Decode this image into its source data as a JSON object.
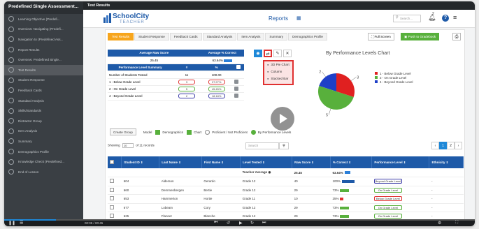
{
  "sidebar": {
    "title": "Predefined Single Assessment...",
    "items": [
      {
        "label": "Learning Objective (Predefi..."
      },
      {
        "label": "Overview: Navigating (Predefi..."
      },
      {
        "label": "Navigation to (Predefined Ass..."
      },
      {
        "label": "Report Results"
      },
      {
        "label": "Overview: Predefined Single..."
      },
      {
        "label": "Test Results"
      },
      {
        "label": "Student Response"
      },
      {
        "label": "Feedback Cards"
      },
      {
        "label": "Standard Analysis"
      },
      {
        "label": "Skills/Standards"
      },
      {
        "label": "Distractor Group"
      },
      {
        "label": "Item Analysis"
      },
      {
        "label": "Summary"
      },
      {
        "label": "Demographics Profile"
      },
      {
        "label": "Knowledge Check (Predefined..."
      },
      {
        "label": "End of Lesson"
      }
    ]
  },
  "topbar": {
    "title": "Test Results"
  },
  "app": {
    "logo_main": "SchoolCity",
    "logo_sub": "TEACHER",
    "page_title": "Reports",
    "search_placeholder": "Search...",
    "notification_count": "2",
    "help_label": "?"
  },
  "tabs": [
    {
      "label": "Test Results"
    },
    {
      "label": "Student Response"
    },
    {
      "label": "Feedback Cards"
    },
    {
      "label": "Standard Analysis"
    },
    {
      "label": "Item Analysis"
    },
    {
      "label": "Summary"
    },
    {
      "label": "Demographics Profile"
    }
  ],
  "toolbar": {
    "fullscreen_label": "Full Screen",
    "push_label": "Push to Gradebook"
  },
  "summary": {
    "avg_header": "Average Raw Score",
    "pct_header": "Average % Correct",
    "avg_value": "25.45",
    "pct_value": "63.64%",
    "level_header": "Performance Level Summary",
    "count_header": "#",
    "percent_header": "%",
    "tested_label": "Number of Students Tested",
    "tested_count": "11",
    "tested_percent": "100.00",
    "levels": [
      {
        "label": "1 - Below Grade Level",
        "count": "3",
        "percent": "27.27%",
        "color": "#e03030"
      },
      {
        "label": "2 - On Grade Level",
        "count": "5",
        "percent": "45.45%",
        "color": "#58b03c"
      },
      {
        "label": "4 - Beyond Grade Level",
        "count": "2",
        "percent": "18.18%",
        "color": "#3a3aa8"
      }
    ]
  },
  "chart_menu": {
    "items": [
      {
        "label": "3D Pie Chart"
      },
      {
        "label": "Column"
      },
      {
        "label": "Stacked Bar"
      }
    ]
  },
  "chart_data": {
    "type": "pie",
    "title": "By Performance Levels Chart",
    "categories": [
      "1 - Below Grade Level",
      "2 - On Grade Level",
      "4 - Beyond Grade Level"
    ],
    "values": [
      3,
      5,
      2
    ],
    "slice_labels": [
      "3",
      "5",
      "2"
    ],
    "colors": [
      "#e02020",
      "#58b03c",
      "#1e3fc8"
    ],
    "legend": "right"
  },
  "options": {
    "create_group": "Create Group",
    "model_label": "Model",
    "demographics": "Demographics",
    "chart": "Chart",
    "proficient": "Proficient / Not Proficient",
    "by_level": "By Performance Levels"
  },
  "list": {
    "showing_prefix": "Showing",
    "page_size": "10",
    "showing_suffix": "of 11 records",
    "search_placeholder": "Search",
    "pages": [
      "1",
      "2"
    ]
  },
  "table": {
    "headers": [
      "Student ID",
      "Last Name",
      "First Name",
      "Level Tested",
      "Raw Score",
      "% Correct",
      "Performance Level",
      "Ethnicity"
    ],
    "average_label": "Teacher Average",
    "average_score": "25.45",
    "average_pct": "63.64%",
    "rows": [
      {
        "id": "604",
        "last": "Alderson",
        "first": "Gerardo",
        "level": "Grade 12",
        "raw": "40",
        "pct": "100%",
        "pct_val": 1.0,
        "perf": "Beyond Grade Level",
        "perf_color": "#3a3aa8",
        "eth": "-"
      },
      {
        "id": "660",
        "last": "Demmenbergen",
        "first": "Bertie",
        "level": "Grade 12",
        "raw": "29",
        "pct": "73%",
        "pct_val": 0.73,
        "perf": "On Grade Level",
        "perf_color": "#58b03c",
        "eth": "-"
      },
      {
        "id": "653",
        "last": "Hammerton",
        "first": "Hortie",
        "level": "Grade 11",
        "raw": "10",
        "pct": "25%",
        "pct_val": 0.25,
        "perf": "Below Grade Level",
        "perf_color": "#e03030",
        "eth": "-"
      },
      {
        "id": "677",
        "last": "Lobeam",
        "first": "Cory",
        "level": "Grade 12",
        "raw": "29",
        "pct": "73%",
        "pct_val": 0.73,
        "perf": "On Grade Level",
        "perf_color": "#58b03c",
        "eth": "-"
      },
      {
        "id": "625",
        "last": "Flanner",
        "first": "Blanche",
        "level": "Grade 12",
        "raw": "29",
        "pct": "73%",
        "pct_val": 0.73,
        "perf": "On Grade Level",
        "perf_color": "#58b03c",
        "eth": "-"
      }
    ]
  },
  "video": {
    "time": "00:05 / 00:45",
    "progress": 0.11
  }
}
